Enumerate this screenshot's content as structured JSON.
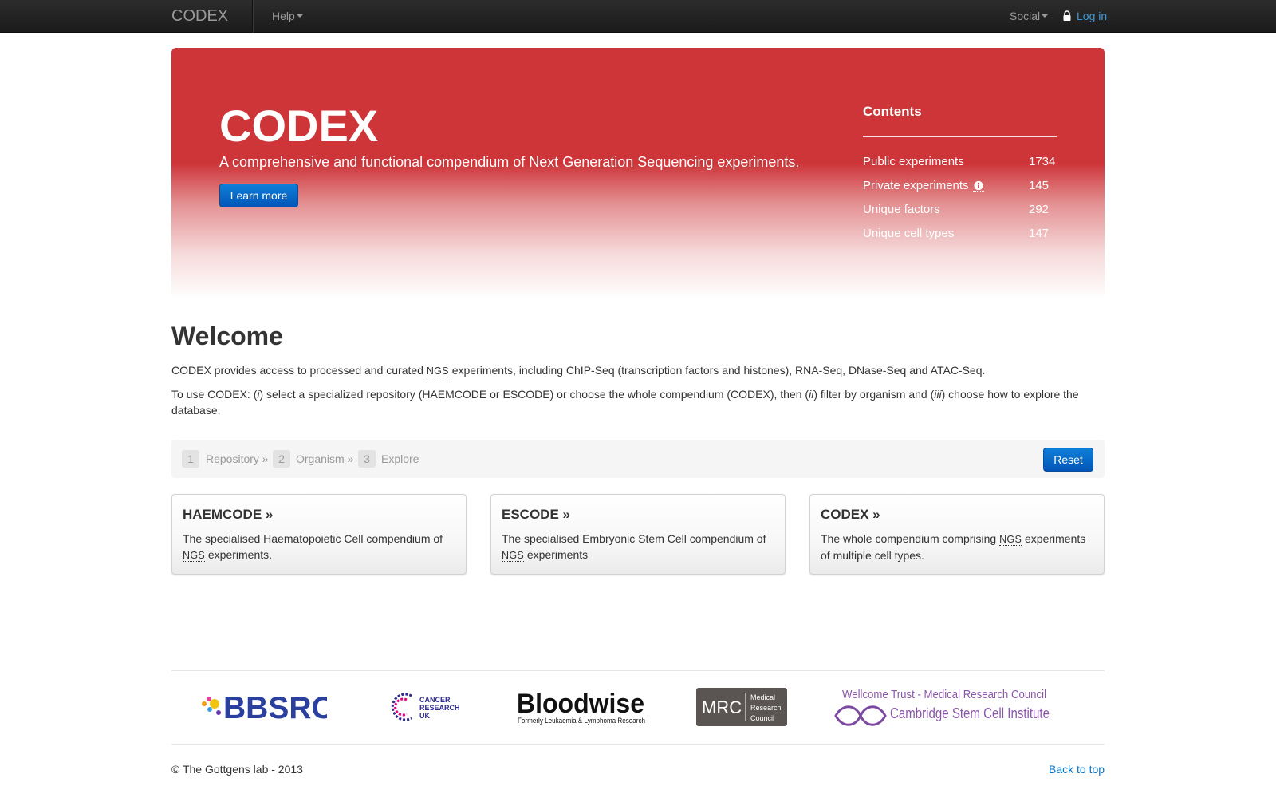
{
  "navbar": {
    "brand": "CODEX",
    "help_label": "Help",
    "social_label": "Social",
    "login_label": "Log in"
  },
  "hero": {
    "title": "CODEX",
    "subtitle": "A comprehensive and functional compendium of Next Generation Sequencing experiments.",
    "learn_more_label": "Learn more",
    "contents": {
      "title": "Contents",
      "rows": [
        {
          "label": "Public experiments",
          "value": "1734"
        },
        {
          "label": "Private experiments",
          "value": "145"
        },
        {
          "label": "Unique factors",
          "value": "292"
        },
        {
          "label": "Unique cell types",
          "value": "147"
        }
      ]
    }
  },
  "welcome": {
    "heading": "Welcome",
    "p1": {
      "before": "CODEX provides access to processed and curated ",
      "abbr": "NGS",
      "after": " experiments, including ChIP-Seq (transcription factors and histones), RNA-Seq, DNase-Seq and ATAC-Seq."
    },
    "p2": {
      "part1": "To use CODEX: (",
      "i1": "i",
      "part2": ") select a specialized repository (HAEMCODE or ESCODE) or choose the whole compendium (CODEX), then (",
      "i2": "ii",
      "part3": ") filter by organism and (",
      "i3": "iii",
      "part4": ") choose how to explore the database."
    }
  },
  "steps": {
    "items": [
      {
        "num": "1",
        "label": "Repository »"
      },
      {
        "num": "2",
        "label": "Organism »"
      },
      {
        "num": "3",
        "label": "Explore"
      }
    ],
    "reset_label": "Reset"
  },
  "cards": [
    {
      "title": "HAEMCODE »",
      "before": "The specialised Haematopoietic Cell compendium of ",
      "abbr": "NGS",
      "after": " experiments."
    },
    {
      "title": "ESCODE »",
      "before": "The specialised Embryonic Stem Cell compendium of ",
      "abbr": "NGS",
      "after": " experiments"
    },
    {
      "title": "CODEX »",
      "before": "The whole compendium comprising ",
      "abbr": "NGS",
      "after": " experiments of multiple cell types."
    }
  ],
  "logos": {
    "bbsrc": "BBSRC",
    "cruk": [
      "CANCER",
      "RESEARCH",
      "UK"
    ],
    "bloodwise_name": "Bloodwise",
    "bloodwise_tagline": "Formerly Leukaemia & Lymphoma Research",
    "mrc_abbr": "MRC",
    "mrc_words": [
      "Medical",
      "Research",
      "Council"
    ],
    "wellcome_top": "Wellcome Trust - Medical Research Council",
    "wellcome_bottom": "Cambridge Stem Cell Institute"
  },
  "footer": {
    "copyright": "© The Gottgens lab - 2013",
    "back_to_top": "Back to top"
  },
  "colors": {
    "hero_red": "#cd3539",
    "button_blue": "#0356b8",
    "link_blue": "#0a75c4",
    "navbar": "#1b1b1b"
  },
  "icons": [
    "lock-icon",
    "info-icon",
    "caret-down-icon"
  ]
}
